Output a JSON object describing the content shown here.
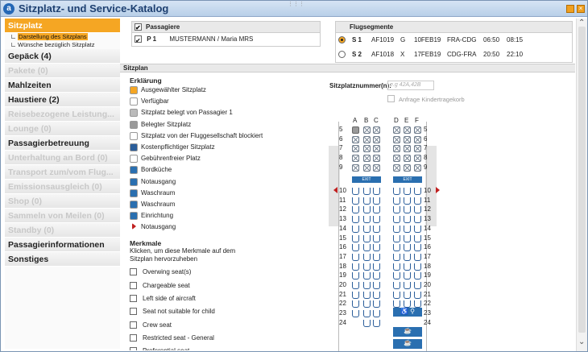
{
  "window": {
    "title": "Sitzplatz- und Service-Katalog",
    "logo": "a"
  },
  "sidebar": {
    "items": [
      {
        "label": "Sitzplatz",
        "state": "active"
      },
      {
        "label": "Gepäck (4)",
        "state": "normal"
      },
      {
        "label": "Pakete (0)",
        "state": "disabled"
      },
      {
        "label": "Mahlzeiten",
        "state": "normal"
      },
      {
        "label": "Haustiere (2)",
        "state": "normal"
      },
      {
        "label": "Reisebezogene Leistung...",
        "state": "disabled"
      },
      {
        "label": "Lounge (0)",
        "state": "disabled"
      },
      {
        "label": "Passagierbetreuung",
        "state": "normal"
      },
      {
        "label": "Unterhaltung an Bord (0)",
        "state": "disabled"
      },
      {
        "label": "Transport zum/vom Flug...",
        "state": "disabled"
      },
      {
        "label": "Emissionsausgleich (0)",
        "state": "disabled"
      },
      {
        "label": "Shop (0)",
        "state": "disabled"
      },
      {
        "label": "Sammeln von Meilen (0)",
        "state": "disabled"
      },
      {
        "label": "Standby (0)",
        "state": "disabled"
      },
      {
        "label": "Passagierinformationen",
        "state": "normal"
      },
      {
        "label": "Sonstiges",
        "state": "normal"
      }
    ],
    "subitems": [
      "Darstellung des Sitzplans",
      "Wünsche bezüglich Sitzplatz"
    ]
  },
  "passengers": {
    "heading": "Passagiere",
    "rows": [
      {
        "id": "P 1",
        "name": "MUSTERMANN / Maria MRS",
        "checked": true
      }
    ]
  },
  "segments": {
    "heading": "Flugsegmente",
    "rows": [
      {
        "id": "S 1",
        "flight": "AF1019",
        "cls": "G",
        "date": "10FEB19",
        "route": "FRA-CDG",
        "dep": "06:50",
        "arr": "08:15",
        "selected": true
      },
      {
        "id": "S 2",
        "flight": "AF1018",
        "cls": "X",
        "date": "17FEB19",
        "route": "CDG-FRA",
        "dep": "20:50",
        "arr": "22:10",
        "selected": false
      }
    ]
  },
  "seatplan": {
    "heading": "Sitzplan",
    "legend_heading": "Erklärung",
    "legend": [
      {
        "label": "Ausgewählter Sitzplatz",
        "icon": "selected-seat-icon",
        "color": "#f5a623"
      },
      {
        "label": "Verfügbar",
        "icon": "available-seat-icon",
        "color": "#ffffff"
      },
      {
        "label": "Sitzplatz belegt von Passagier 1",
        "icon": "passenger-seat-icon",
        "color": "#bbbbbb"
      },
      {
        "label": "Belegter Sitzplatz",
        "icon": "occupied-seat-icon",
        "color": "#999999"
      },
      {
        "label": "Sitzplatz von der Fluggesellschaft blockiert",
        "icon": "blocked-seat-icon",
        "color": "#ffffff"
      },
      {
        "label": "Kostenpflichtiger Sitzplatz",
        "icon": "chargeable-seat-icon",
        "color": "#2a5d9a"
      },
      {
        "label": "Gebührenfreier Platz",
        "icon": "free-seat-icon",
        "color": "#ffffff"
      },
      {
        "label": "Bordküche",
        "icon": "galley-icon",
        "color": "#2a6fb0"
      },
      {
        "label": "Notausgang",
        "icon": "exit-icon",
        "color": "#2a6fb0"
      },
      {
        "label": "Waschraum",
        "icon": "lavatory-icon",
        "color": "#2a6fb0"
      },
      {
        "label": "Waschraum",
        "icon": "lavatory-accessible-icon",
        "color": "#2a6fb0"
      },
      {
        "label": "Einrichtung",
        "icon": "facility-icon",
        "color": "#2a6fb0"
      },
      {
        "label": "Notausgang",
        "icon": "exit-arrow-icon",
        "color": "#c02020"
      }
    ],
    "features_heading": "Merkmale",
    "features_hint": "Klicken, um diese Merkmale auf dem Sitzplan hervorzuheben",
    "features": [
      "Overwing seat(s)",
      "Chargeable seat",
      "Left side of aircraft",
      "Seat not suitable for child",
      "Crew seat",
      "Restricted seat - General",
      "Preferential seat"
    ],
    "seatno_label": "Sitzplatznummer(n):",
    "seatno_placeholder": "e.g 42A,42B",
    "child_request_label": "Anfrage Kindertragekorb",
    "columns_left": [
      "A",
      "B",
      "C"
    ],
    "columns_right": [
      "D",
      "E",
      "F"
    ],
    "rows": [
      "5",
      "6",
      "7",
      "8",
      "9",
      "10",
      "11",
      "12",
      "13",
      "14",
      "15",
      "16",
      "17",
      "18",
      "19",
      "20",
      "21",
      "22",
      "23",
      "24"
    ],
    "exit_label": "EXIT"
  }
}
